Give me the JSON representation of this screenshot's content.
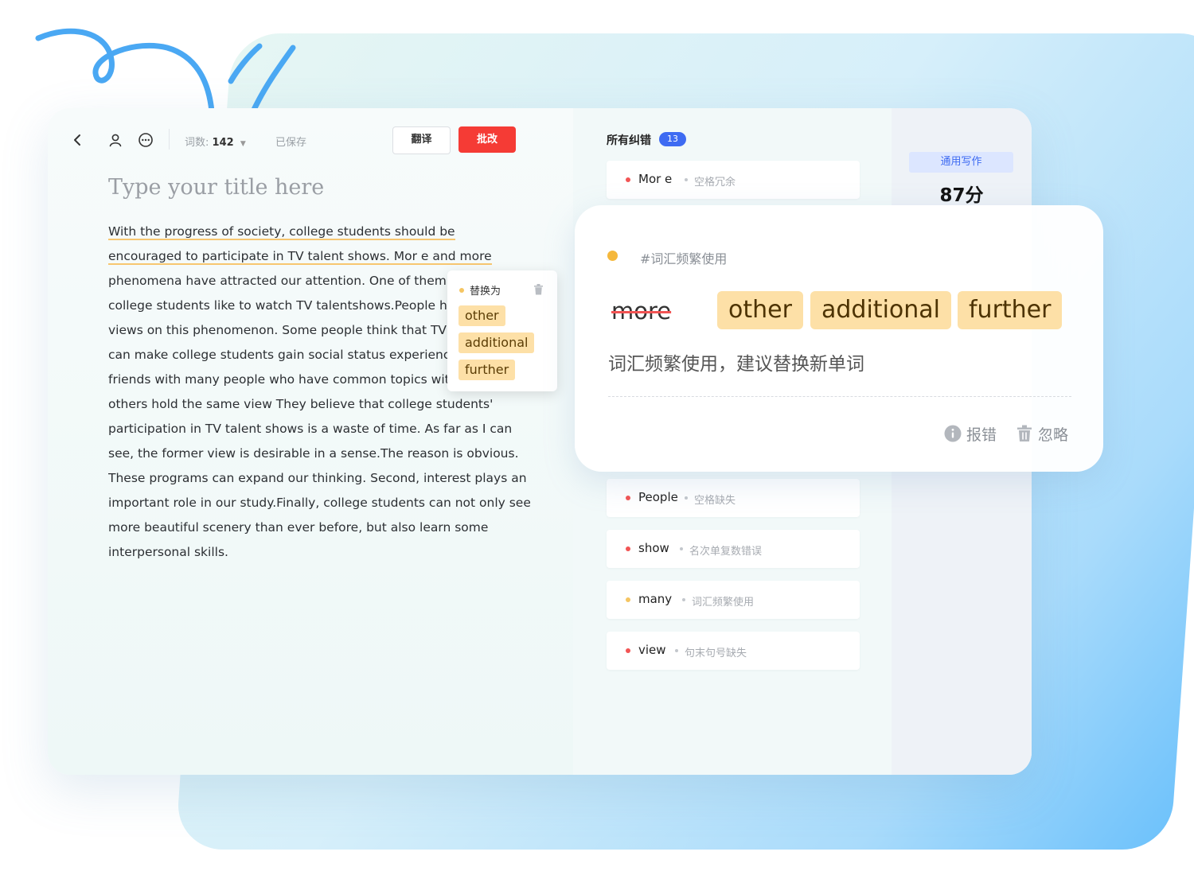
{
  "toolbar": {
    "word_count_label": "词数:",
    "word_count_value": "142",
    "saved_status": "已保存",
    "translate_label": "翻译",
    "review_label": "批改"
  },
  "document": {
    "title_placeholder": "Type your title here",
    "body_lines": [
      "With the progress of society, college students should be",
      "encouraged to participate in TV talent shows. Mor e and more",
      "phenomena have attracted our attention. One of them is",
      "college students like to watch TV talentshows.People hol",
      "views on this phenomenon. Some people think that TV ta",
      "can make college students gain social status experience",
      "friends with many people who have common topics with",
      "others hold the same view They believe that college students'",
      "participation in TV talent shows is a waste of time. As far as I can",
      "see, the former view is desirable in a sense.The reason is obvious.",
      "These programs can expand our thinking. Second, interest plays an",
      "important role in our study.Finally, college students can not only see",
      "more beautiful scenery than ever before, but also learn some",
      "interpersonal skills."
    ]
  },
  "popover": {
    "title": "替换为",
    "options": [
      "other",
      "additional",
      "further"
    ]
  },
  "issues_panel": {
    "title": "所有纠错",
    "count": "13",
    "items": [
      {
        "word": "Mor e",
        "type": "空格冗余",
        "dot": "#f25454"
      },
      {
        "word": "People",
        "type": "空格缺失",
        "dot": "#f25454"
      },
      {
        "word": "show",
        "type": "名次单复数错误",
        "dot": "#f25454"
      },
      {
        "word": "many",
        "type": "词汇频繁使用",
        "dot": "#f5c562"
      },
      {
        "word": "view",
        "type": "句末句号缺失",
        "dot": "#f25454"
      }
    ]
  },
  "score_panel": {
    "category": "通用写作",
    "score": "87分"
  },
  "detail_card": {
    "tag": "#词汇频繁使用",
    "original": "more",
    "suggestions": [
      "other",
      "additional",
      "further"
    ],
    "description": "词汇频繁使用，建议替换新单词",
    "report_label": "报错",
    "ignore_label": "忽略"
  },
  "colors": {
    "accent_red": "#f53b35",
    "badge_blue": "#3e6bf2",
    "suggestion_bg": "#fde0a7",
    "underline_yellow": "#f7c670",
    "underline_red": "#f47a7a"
  }
}
